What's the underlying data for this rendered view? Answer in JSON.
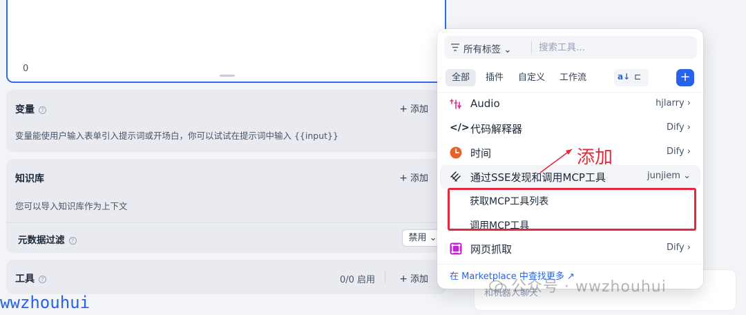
{
  "editor": {
    "char_count": "0"
  },
  "variables": {
    "title": "变量",
    "add_label": "添加",
    "description": "变量能使用户输入表单引入提示词或开场白，你可以试试在提示词中输入 {{input}}"
  },
  "knowledge": {
    "title": "知识库",
    "add_label": "添加",
    "description": "您可以导入知识库作为上下文",
    "metadata_filter_label": "元数据过滤",
    "metadata_filter_value": "禁用"
  },
  "tools_card": {
    "title": "工具",
    "enabled_count": "0/0 启用",
    "add_label": "添加"
  },
  "watermark_left": "wwzhouhui",
  "chat_input": {
    "placeholder": "和机器人聊天"
  },
  "tool_picker": {
    "tag_filter_label": "所有标签",
    "search_placeholder": "搜索工具...",
    "tabs": [
      {
        "label": "全部",
        "active": true
      },
      {
        "label": "插件",
        "active": false
      },
      {
        "label": "自定义",
        "active": false
      },
      {
        "label": "工作流",
        "active": false
      }
    ],
    "tools": [
      {
        "name": "Audio",
        "author": "hjlarry",
        "icon": "audio-icon"
      },
      {
        "name": "代码解释器",
        "author": "Dify",
        "icon": "code-icon"
      },
      {
        "name": "时间",
        "author": "Dify",
        "icon": "clock-icon"
      },
      {
        "name": "通过SSE发现和调用MCP工具",
        "author": "junjiem",
        "icon": "mcp-icon",
        "expanded": true
      },
      {
        "name": "网页抓取",
        "author": "Dify",
        "icon": "web-scraper-icon"
      }
    ],
    "sub_tools": [
      "获取MCP工具列表",
      "调用MCP工具"
    ],
    "marketplace_link": "在 Marketplace 中查找更多 ↗"
  },
  "annotation": {
    "text": "添加",
    "color": "#e5283b"
  },
  "watermark_right": "公众号 · wwzhouhui",
  "colors": {
    "accent": "#2563eb",
    "annotation": "#e5283b"
  }
}
